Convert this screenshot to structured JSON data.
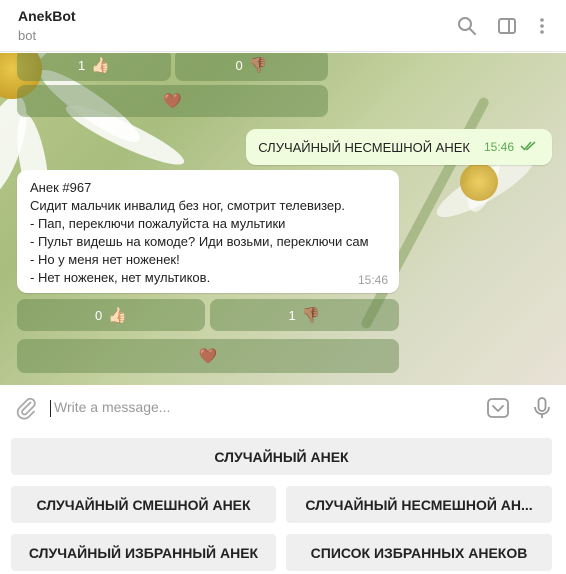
{
  "header": {
    "title": "AnekBot",
    "subtitle": "bot",
    "icons": [
      "search-icon",
      "sidebar-panel-icon",
      "more-vertical-icon"
    ]
  },
  "chat": {
    "top_buttons": {
      "like_count": "1",
      "like_emoji": "👍🏻",
      "dislike_count": "0",
      "dislike_emoji": "👎🏽",
      "heart_emoji": "🤎"
    },
    "outgoing": {
      "text": "СЛУЧАЙНЫЙ НЕСМЕШНОЙ АНЕК",
      "time": "15:46",
      "status": "read"
    },
    "incoming": {
      "lines": [
        "Анек #967",
        "Сидит мальчик инвалид без ног, смотрит телевизер.",
        "- Пап, переключи пожалуйста на мультики",
        "- Пульт видешь на комоде? Иди возьми, переключи сам",
        "- Но у меня нет ноженек!",
        "- Нет ноженек, нет мультиков."
      ],
      "time": "15:46"
    },
    "bottom_buttons": {
      "like_count": "0",
      "like_emoji": "👍🏻",
      "dislike_count": "1",
      "dislike_emoji": "👎🏽",
      "heart_emoji": "🤎"
    },
    "colors": {
      "outgoing_bubble": "#effdde",
      "read_ticks": "#5ca853"
    }
  },
  "input": {
    "placeholder": "Write a message..."
  },
  "reply_keyboard": {
    "random": "СЛУЧАЙНЫЙ АНЕК",
    "random_funny": "СЛУЧАЙНЫЙ СМЕШНОЙ АНЕК",
    "random_unfunny": "СЛУЧАЙНЫЙ НЕСМЕШНОЙ АН...",
    "random_favorite": "СЛУЧАЙНЫЙ ИЗБРАННЫЙ АНЕК",
    "favorites_list": "СПИСОК ИЗБРАННЫХ АНЕКОВ"
  }
}
